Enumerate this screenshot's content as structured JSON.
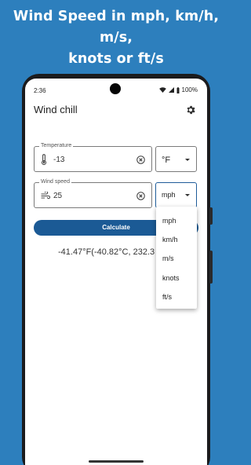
{
  "headline": {
    "line1": "Wind Speed in mph, km/h, m/s,",
    "line2": "knots or ft/s"
  },
  "status_bar": {
    "time": "2:36",
    "battery": "100%"
  },
  "app_bar": {
    "title": "Wind chill",
    "settings_icon": "gear-icon"
  },
  "temperature": {
    "label": "Temperature",
    "value": "-13",
    "icon": "thermometer-icon",
    "unit": "°F"
  },
  "wind_speed": {
    "label": "Wind speed",
    "value": "25",
    "icon": "wind-icon",
    "unit": "mph"
  },
  "unit_menu": {
    "options": [
      "mph",
      "km/h",
      "m/s",
      "knots",
      "ft/s"
    ]
  },
  "calculate_label": "Calculate",
  "result": "-41.47°F(-40.82°C, 232.3",
  "colors": {
    "background": "#2d7fbd",
    "primary": "#1b5a95",
    "focus": "#1f5c99"
  }
}
